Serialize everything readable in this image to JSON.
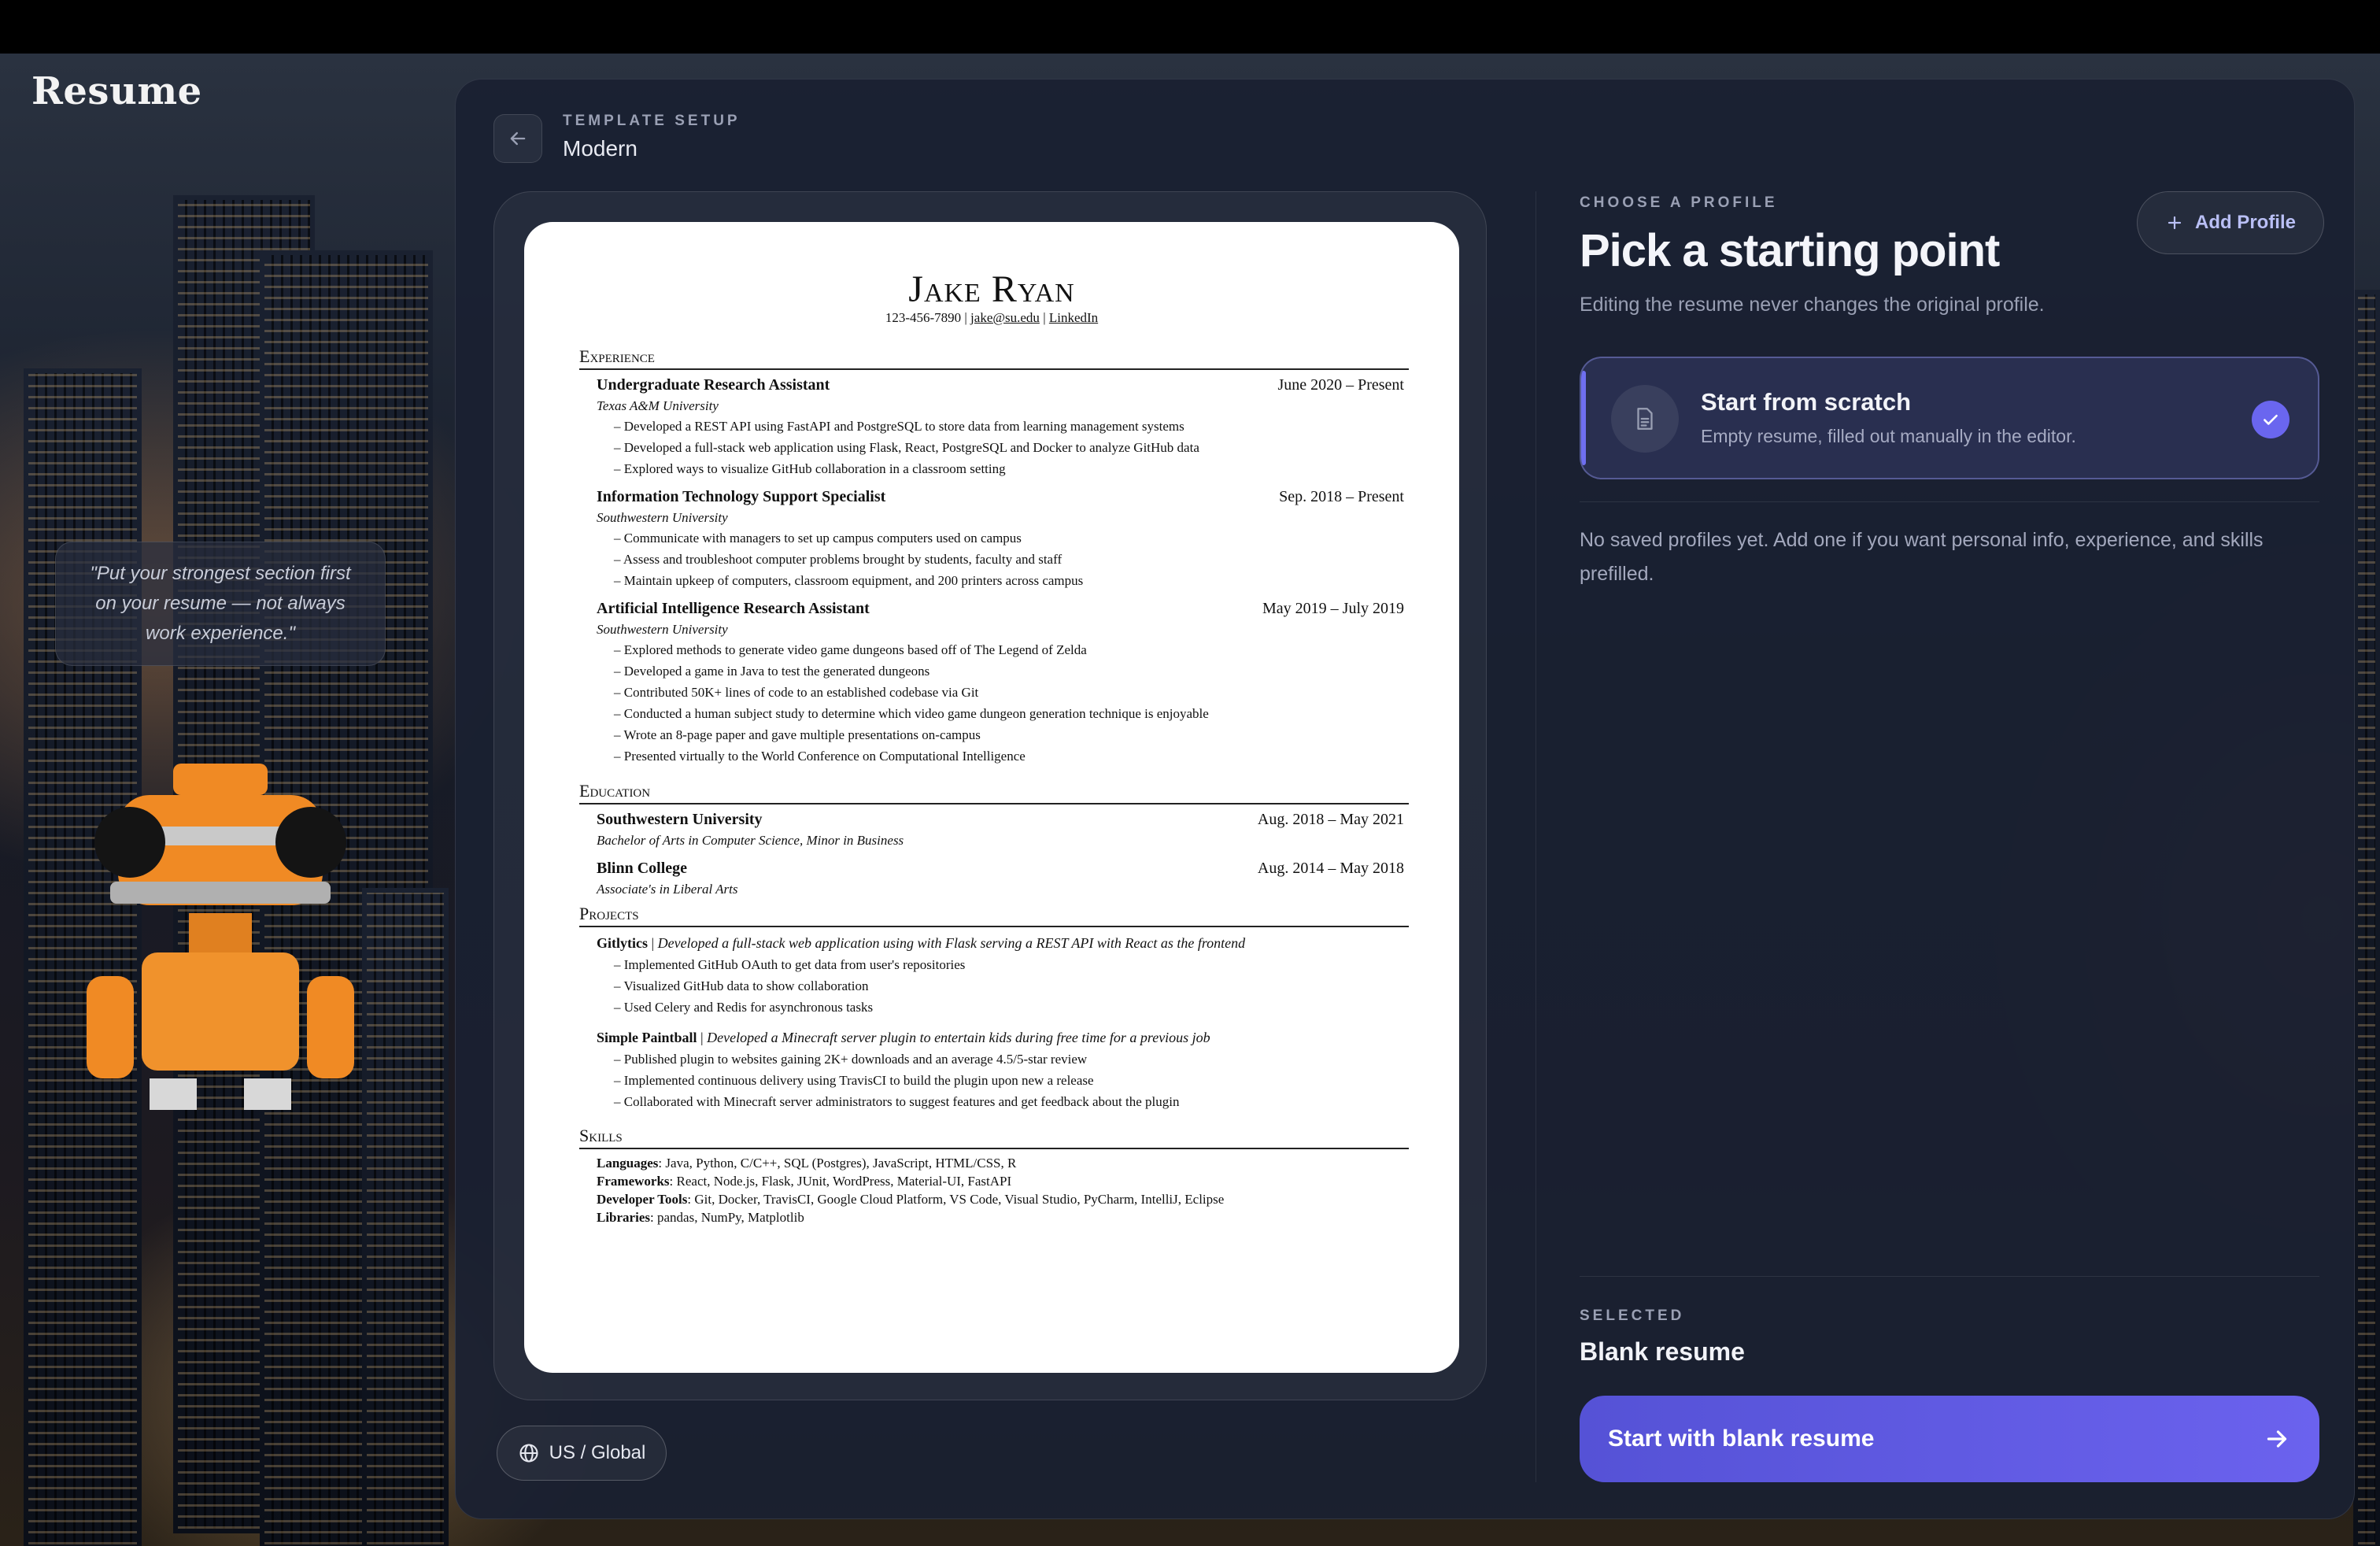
{
  "app": {
    "brand": "Resume"
  },
  "sidebar": {
    "quote": "\"Put your strongest section first on your resume — not always work experience.\""
  },
  "header": {
    "eyebrow": "TEMPLATE SETUP",
    "template_name": "Modern"
  },
  "preview": {
    "name": "Jake Ryan",
    "contact": {
      "phone": "123-456-7890",
      "email": "jake@su.edu",
      "link": "LinkedIn"
    },
    "sections": {
      "experience": "Experience",
      "education": "Education",
      "projects": "Projects",
      "skills": "Skills"
    },
    "experience": [
      {
        "title": "Undergraduate Research Assistant",
        "dates": "June 2020 – Present",
        "org": "Texas A&M University",
        "bullets": [
          "Developed a REST API using FastAPI and PostgreSQL to store data from learning management systems",
          "Developed a full-stack web application using Flask, React, PostgreSQL and Docker to analyze GitHub data",
          "Explored ways to visualize GitHub collaboration in a classroom setting"
        ]
      },
      {
        "title": "Information Technology Support Specialist",
        "dates": "Sep. 2018 – Present",
        "org": "Southwestern University",
        "bullets": [
          "Communicate with managers to set up campus computers used on campus",
          "Assess and troubleshoot computer problems brought by students, faculty and staff",
          "Maintain upkeep of computers, classroom equipment, and 200 printers across campus"
        ]
      },
      {
        "title": "Artificial Intelligence Research Assistant",
        "dates": "May 2019 – July 2019",
        "org": "Southwestern University",
        "bullets": [
          "Explored methods to generate video game dungeons based off of The Legend of Zelda",
          "Developed a game in Java to test the generated dungeons",
          "Contributed 50K+ lines of code to an established codebase via Git",
          "Conducted a human subject study to determine which video game dungeon generation technique is enjoyable",
          "Wrote an 8-page paper and gave multiple presentations on-campus",
          "Presented virtually to the World Conference on Computational Intelligence"
        ]
      }
    ],
    "education": [
      {
        "school": "Southwestern University",
        "dates": "Aug. 2018 – May 2021",
        "degree": "Bachelor of Arts in Computer Science, Minor in Business"
      },
      {
        "school": "Blinn College",
        "dates": "Aug. 2014 – May 2018",
        "degree": "Associate's in Liberal Arts"
      }
    ],
    "projects": [
      {
        "name": "Gitlytics",
        "desc": "Developed a full-stack web application using with Flask serving a REST API with React as the frontend",
        "bullets": [
          "Implemented GitHub OAuth to get data from user's repositories",
          "Visualized GitHub data to show collaboration",
          "Used Celery and Redis for asynchronous tasks"
        ]
      },
      {
        "name": "Simple Paintball",
        "desc": "Developed a Minecraft server plugin to entertain kids during free time for a previous job",
        "bullets": [
          "Published plugin to websites gaining 2K+ downloads and an average 4.5/5-star review",
          "Implemented continuous delivery using TravisCI to build the plugin upon new a release",
          "Collaborated with Minecraft server administrators to suggest features and get feedback about the plugin"
        ]
      }
    ],
    "skills": [
      {
        "label": "Languages",
        "value": "Java, Python, C/C++, SQL (Postgres), JavaScript, HTML/CSS, R"
      },
      {
        "label": "Frameworks",
        "value": "React, Node.js, Flask, JUnit, WordPress, Material-UI, FastAPI"
      },
      {
        "label": "Developer Tools",
        "value": "Git, Docker, TravisCI, Google Cloud Platform, VS Code, Visual Studio, PyCharm, IntelliJ, Eclipse"
      },
      {
        "label": "Libraries",
        "value": "pandas, NumPy, Matplotlib"
      }
    ]
  },
  "region": {
    "label": "US / Global"
  },
  "profile": {
    "eyebrow": "CHOOSE A PROFILE",
    "title": "Pick a starting point",
    "description": "Editing the resume never changes the original profile.",
    "add_button": "Add Profile",
    "option": {
      "title": "Start from scratch",
      "subtitle": "Empty resume, filled out manually in the editor."
    },
    "empty_message": "No saved profiles yet. Add one if you want personal info, experience, and skills prefilled."
  },
  "selection": {
    "eyebrow": "SELECTED",
    "value": "Blank resume",
    "cta": "Start with blank resume"
  },
  "colors": {
    "accent": "#6a66ef",
    "panel": "#1a2032",
    "cta_start": "#5552d6",
    "cta_end": "#6b62ee"
  },
  "icons": {
    "back": "arrow-left-icon",
    "globe": "globe-icon",
    "plus": "plus-icon",
    "document": "document-icon",
    "check": "check-icon",
    "arrow": "arrow-right-icon"
  }
}
